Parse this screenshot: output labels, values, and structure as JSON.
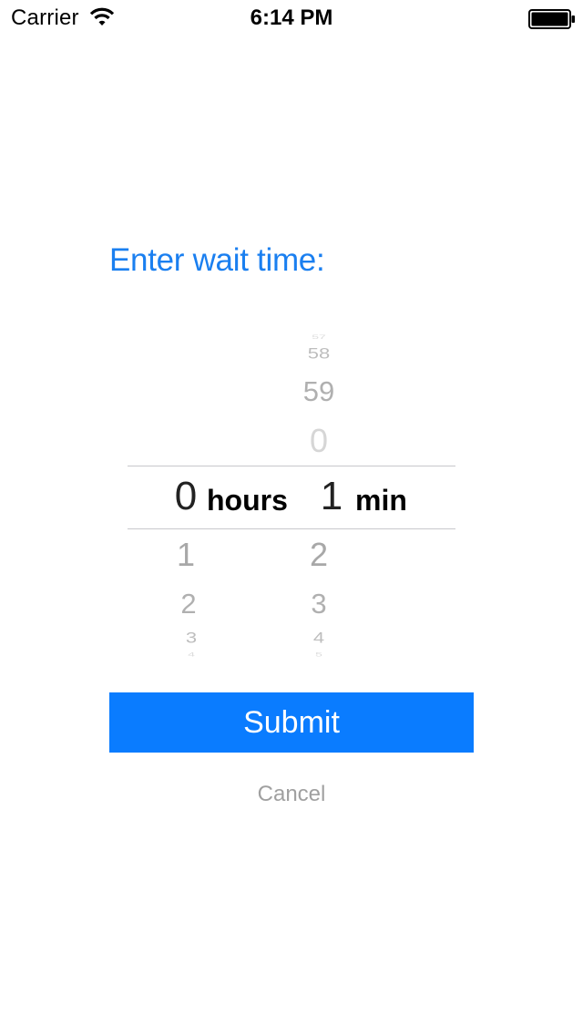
{
  "status_bar": {
    "carrier": "Carrier",
    "time": "6:14 PM",
    "icons": [
      "wifi-icon",
      "battery-icon"
    ]
  },
  "prompt": {
    "label": "Enter wait time:"
  },
  "picker": {
    "hours": {
      "selected": "0",
      "unit": "hours",
      "below": [
        "1",
        "2",
        "3",
        "4"
      ]
    },
    "minutes": {
      "selected": "1",
      "unit": "min",
      "above": [
        "57",
        "58",
        "59",
        "0"
      ],
      "below": [
        "2",
        "3",
        "4",
        "5"
      ]
    }
  },
  "actions": {
    "submit_label": "Submit",
    "cancel_label": "Cancel"
  },
  "colors": {
    "accent": "#0a7cff",
    "prompt": "#1a7ff0",
    "muted": "#a0a0a0"
  }
}
